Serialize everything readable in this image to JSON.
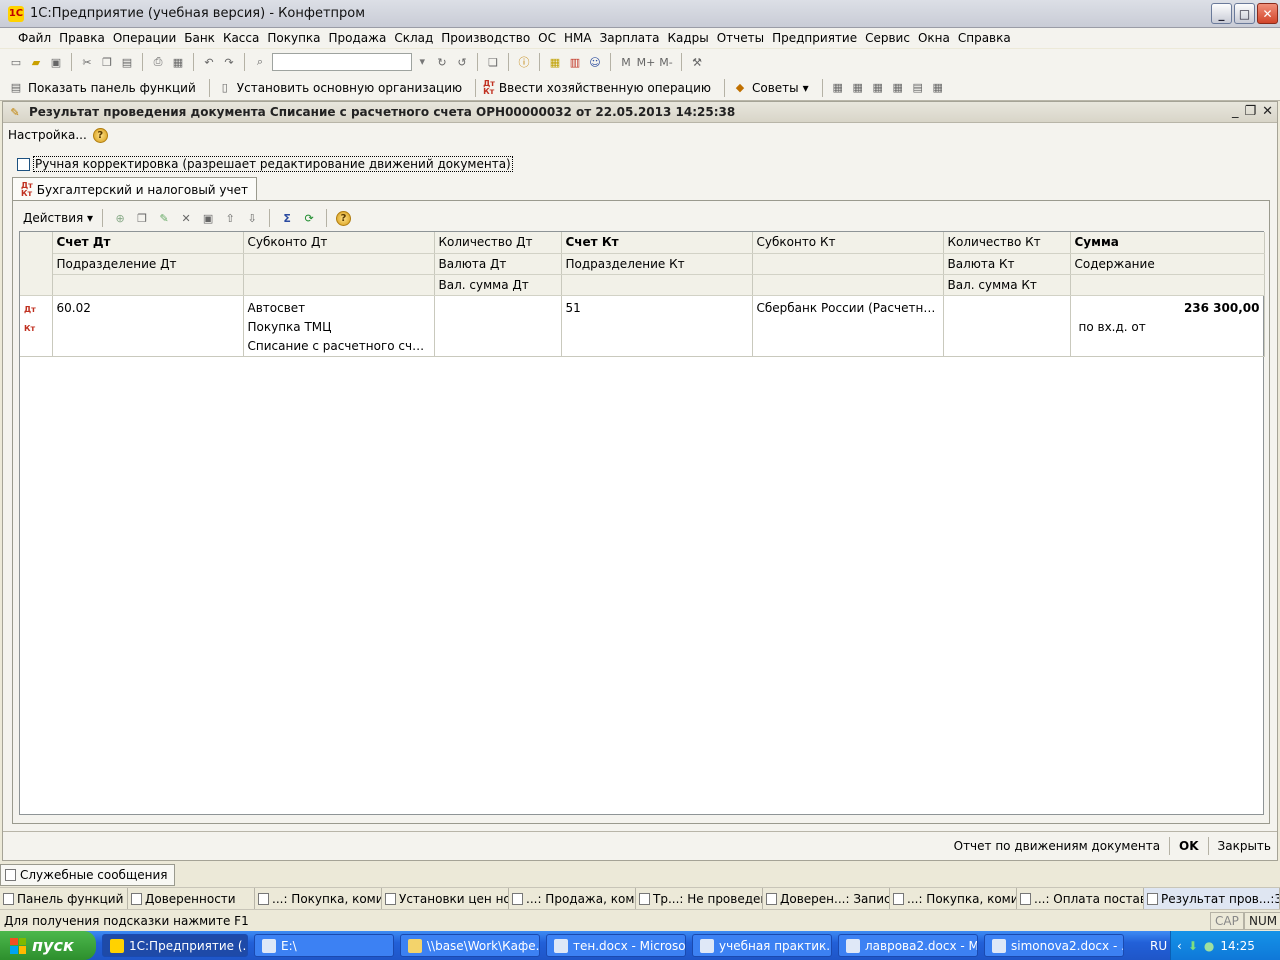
{
  "window": {
    "title": "1С:Предприятие (учебная версия) - Конфетпром",
    "min": "_",
    "max": "□",
    "close": "✕"
  },
  "menu": [
    "Файл",
    "Правка",
    "Операции",
    "Банк",
    "Касса",
    "Покупка",
    "Продажа",
    "Склад",
    "Производство",
    "ОС",
    "НМА",
    "Зарплата",
    "Кадры",
    "Отчеты",
    "Предприятие",
    "Сервис",
    "Окна",
    "Справка"
  ],
  "toolbar2": {
    "show_panel": "Показать панель функций",
    "set_org": "Установить основную организацию",
    "enter_op": "Ввести хозяйственную операцию",
    "tips": "Советы"
  },
  "document": {
    "title": "Результат проведения документа Списание с расчетного счета ОРН00000032 от 22.05.2013 14:25:38",
    "settings": "Настройка...",
    "manual": "Ручная корректировка (разрешает редактирование движений документа)",
    "tab": "Бухгалтерский и налоговый учет",
    "actions": "Действия",
    "columns": {
      "r1": [
        "Счет Дт",
        "Субконто Дт",
        "Количество Дт",
        "Счет Кт",
        "Субконто Кт",
        "Количество Кт",
        "Сумма"
      ],
      "r2": [
        "Подразделение Дт",
        "",
        "Валюта Дт",
        "Подразделение Кт",
        "",
        "Валюта Кт",
        "Содержание"
      ],
      "r3": [
        "",
        "",
        "Вал. сумма Дт",
        "",
        "",
        "Вал. сумма Кт",
        ""
      ]
    },
    "rows": [
      {
        "account_dt": "60.02",
        "subconto_dt": [
          "Автосвет",
          "Покупка ТМЦ",
          "Списание с расчетного счета ОР..."
        ],
        "account_kt": "51",
        "subconto_kt": "Сбербанк России (Расчетный)",
        "sum": "236 300,00",
        "content": "по вх.д. от"
      }
    ],
    "report_btn": "Отчет по движениям документа",
    "ok": "OK",
    "close": "Закрыть"
  },
  "service_messages": "Служебные сообщения",
  "window_tabs": [
    "Панель функций",
    "Доверенности",
    "...: Покупка, коми...",
    "Установки цен но...",
    "...: Продажа, коми...",
    "Тр...: Не проведен *",
    "Доверен...: Записан",
    "...: Покупка, коми...",
    "...: Оплата постав...",
    "Результат пров...:38"
  ],
  "status": {
    "hint": "Для получения подсказки нажмите F1",
    "cap": "CAP",
    "num": "NUM"
  },
  "taskbar": {
    "start": "пуск",
    "tasks": [
      "1С:Предприятие (...",
      "E:\\",
      "\\\\base\\Work\\Кафе...",
      "тен.docx - Microso...",
      "учебная практик...",
      "лаврова2.docx - M...",
      "simonova2.docx - ..."
    ],
    "lang": "RU",
    "clock": "14:25"
  }
}
